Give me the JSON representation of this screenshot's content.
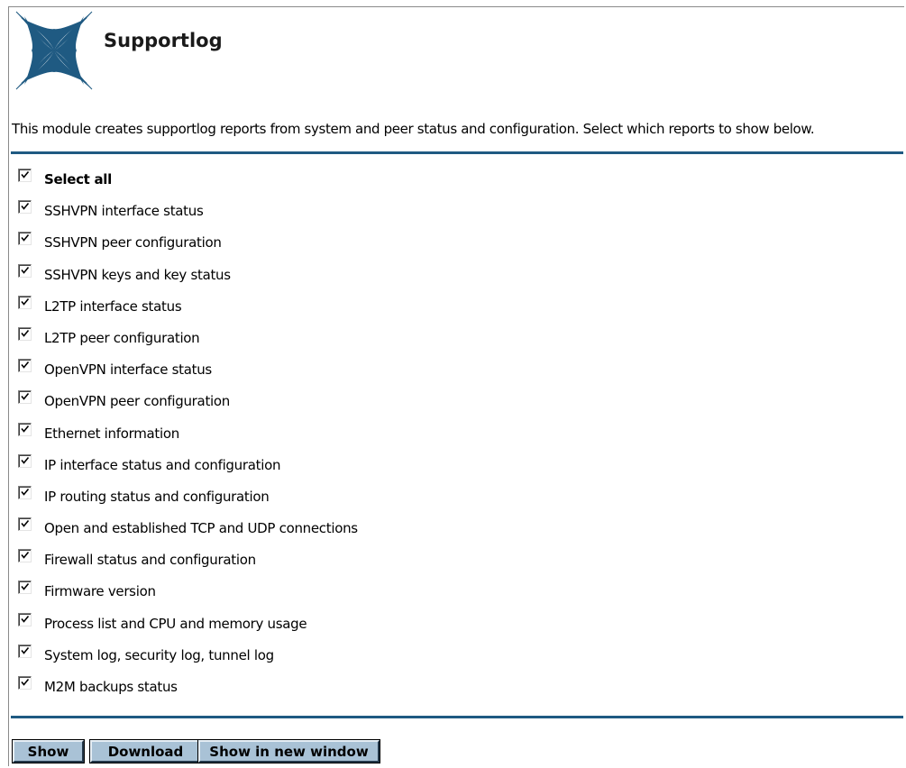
{
  "header": {
    "title": "Supportlog",
    "logo_icon": "blue-four-point-star-logo",
    "accent_color": "#1f5a82"
  },
  "description": "This module creates supportlog reports from system and peer status and configuration. Select which reports to show below.",
  "options": [
    {
      "label": "Select all",
      "checked": true
    },
    {
      "label": "SSHVPN interface status",
      "checked": true
    },
    {
      "label": "SSHVPN peer configuration",
      "checked": true
    },
    {
      "label": "SSHVPN keys and key status",
      "checked": true
    },
    {
      "label": "L2TP interface status",
      "checked": true
    },
    {
      "label": "L2TP peer configuration",
      "checked": true
    },
    {
      "label": "OpenVPN interface status",
      "checked": true
    },
    {
      "label": "OpenVPN peer configuration",
      "checked": true
    },
    {
      "label": "Ethernet information",
      "checked": true
    },
    {
      "label": "IP interface status and configuration",
      "checked": true
    },
    {
      "label": "IP routing status and configuration",
      "checked": true
    },
    {
      "label": "Open and established TCP and UDP connections",
      "checked": true
    },
    {
      "label": "Firewall status and configuration",
      "checked": true
    },
    {
      "label": "Firmware version",
      "checked": true
    },
    {
      "label": "Process list and CPU and memory usage",
      "checked": true
    },
    {
      "label": "System log, security log, tunnel log",
      "checked": true
    },
    {
      "label": "M2M backups status",
      "checked": true
    }
  ],
  "buttons": {
    "show": "Show",
    "download": "Download",
    "show_new_window": "Show in new window",
    "button_color": "#a9c2d6"
  }
}
